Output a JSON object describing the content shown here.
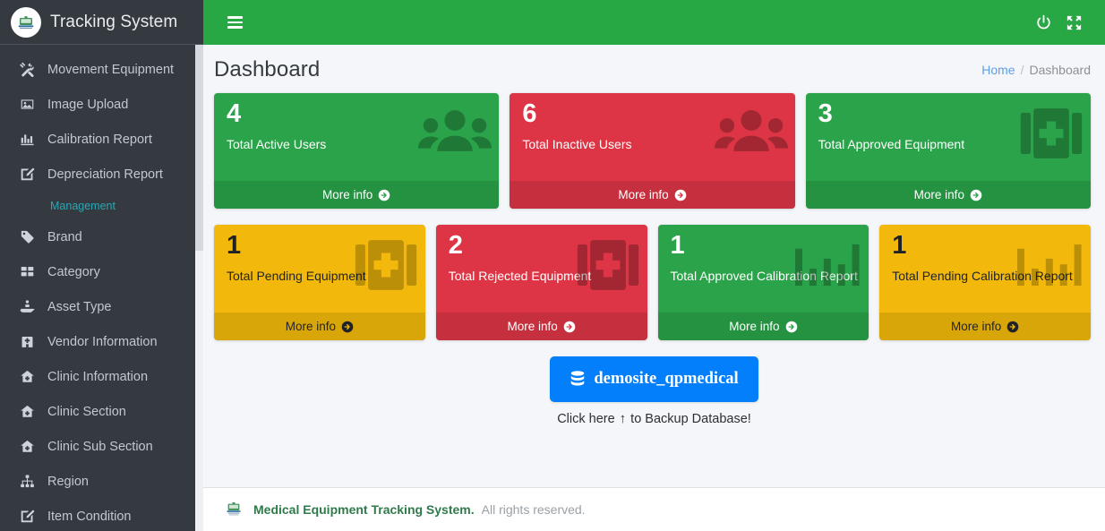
{
  "sidebar": {
    "brand": "Tracking System",
    "logo_icon": "clinic-logo-icon",
    "items": [
      {
        "label": "Movement Equipment",
        "icon": "tools-icon",
        "type": "item"
      },
      {
        "label": "Image Upload",
        "icon": "image-icon",
        "type": "item"
      },
      {
        "label": "Calibration Report",
        "icon": "bar-chart-icon",
        "type": "item"
      },
      {
        "label": "Depreciation Report",
        "icon": "edit-square-icon",
        "type": "item"
      },
      {
        "label": "Management",
        "icon": "",
        "type": "header"
      },
      {
        "label": "Brand",
        "icon": "tag-icon",
        "type": "item"
      },
      {
        "label": "Category",
        "icon": "grid-icon",
        "type": "item"
      },
      {
        "label": "Asset Type",
        "icon": "hand-holding-icon",
        "type": "item"
      },
      {
        "label": "Vendor Information",
        "icon": "building-icon",
        "type": "item"
      },
      {
        "label": "Clinic Information",
        "icon": "clinic-house-icon",
        "type": "item"
      },
      {
        "label": "Clinic Section",
        "icon": "clinic-house-icon",
        "type": "item"
      },
      {
        "label": "Clinic Sub Section",
        "icon": "clinic-house-icon",
        "type": "item"
      },
      {
        "label": "Region",
        "icon": "sitemap-icon",
        "type": "item"
      },
      {
        "label": "Item Condition",
        "icon": "edit-square-icon",
        "type": "item"
      }
    ]
  },
  "topbar": {
    "menu_icon": "hamburger-icon",
    "power_icon": "power-icon",
    "fullscreen_icon": "fullscreen-icon",
    "accent_color": "#28a745"
  },
  "content": {
    "page_title": "Dashboard",
    "breadcrumb": {
      "home": "Home",
      "separator": "/",
      "current": "Dashboard"
    }
  },
  "cards": {
    "more_info_label": "More info",
    "rows": [
      [
        {
          "count": "4",
          "label": "Total Active Users",
          "color": "#2aa34a",
          "theme": "bg-green",
          "text": "text-light",
          "icon": "users-icon"
        },
        {
          "count": "6",
          "label": "Total Inactive Users",
          "color": "#dd3545",
          "theme": "bg-red",
          "text": "text-light",
          "icon": "users-icon"
        },
        {
          "count": "3",
          "label": "Total Approved Equipment",
          "color": "#2aa34a",
          "theme": "bg-green",
          "text": "text-light",
          "icon": "medkit-icon"
        }
      ],
      [
        {
          "count": "1",
          "label": "Total Pending Equipment",
          "color": "#f2b90c",
          "theme": "bg-yellow",
          "text": "text-dark",
          "icon": "medkit-icon"
        },
        {
          "count": "2",
          "label": "Total Rejected Equipment",
          "color": "#dd3545",
          "theme": "bg-red",
          "text": "text-light",
          "icon": "medkit-icon"
        },
        {
          "count": "1",
          "label": "Total Approved Calibration Report",
          "color": "#2aa34a",
          "theme": "bg-green",
          "text": "text-light",
          "icon": "bar-chart-icon"
        },
        {
          "count": "1",
          "label": "Total Pending Calibration Report",
          "color": "#f2b90c",
          "theme": "bg-yellow",
          "text": "text-dark",
          "icon": "bar-chart-icon"
        }
      ]
    ]
  },
  "backup": {
    "button_label": "demosite_qpmedical",
    "button_icon": "database-icon",
    "button_color": "#037ffc",
    "caption_before": "Click here",
    "caption_arrow": "↑",
    "caption_after": "to Backup Database!"
  },
  "footer": {
    "logo_icon": "clinic-logo-icon",
    "strong": "Medical Equipment Tracking System.",
    "rest": "All rights reserved."
  }
}
